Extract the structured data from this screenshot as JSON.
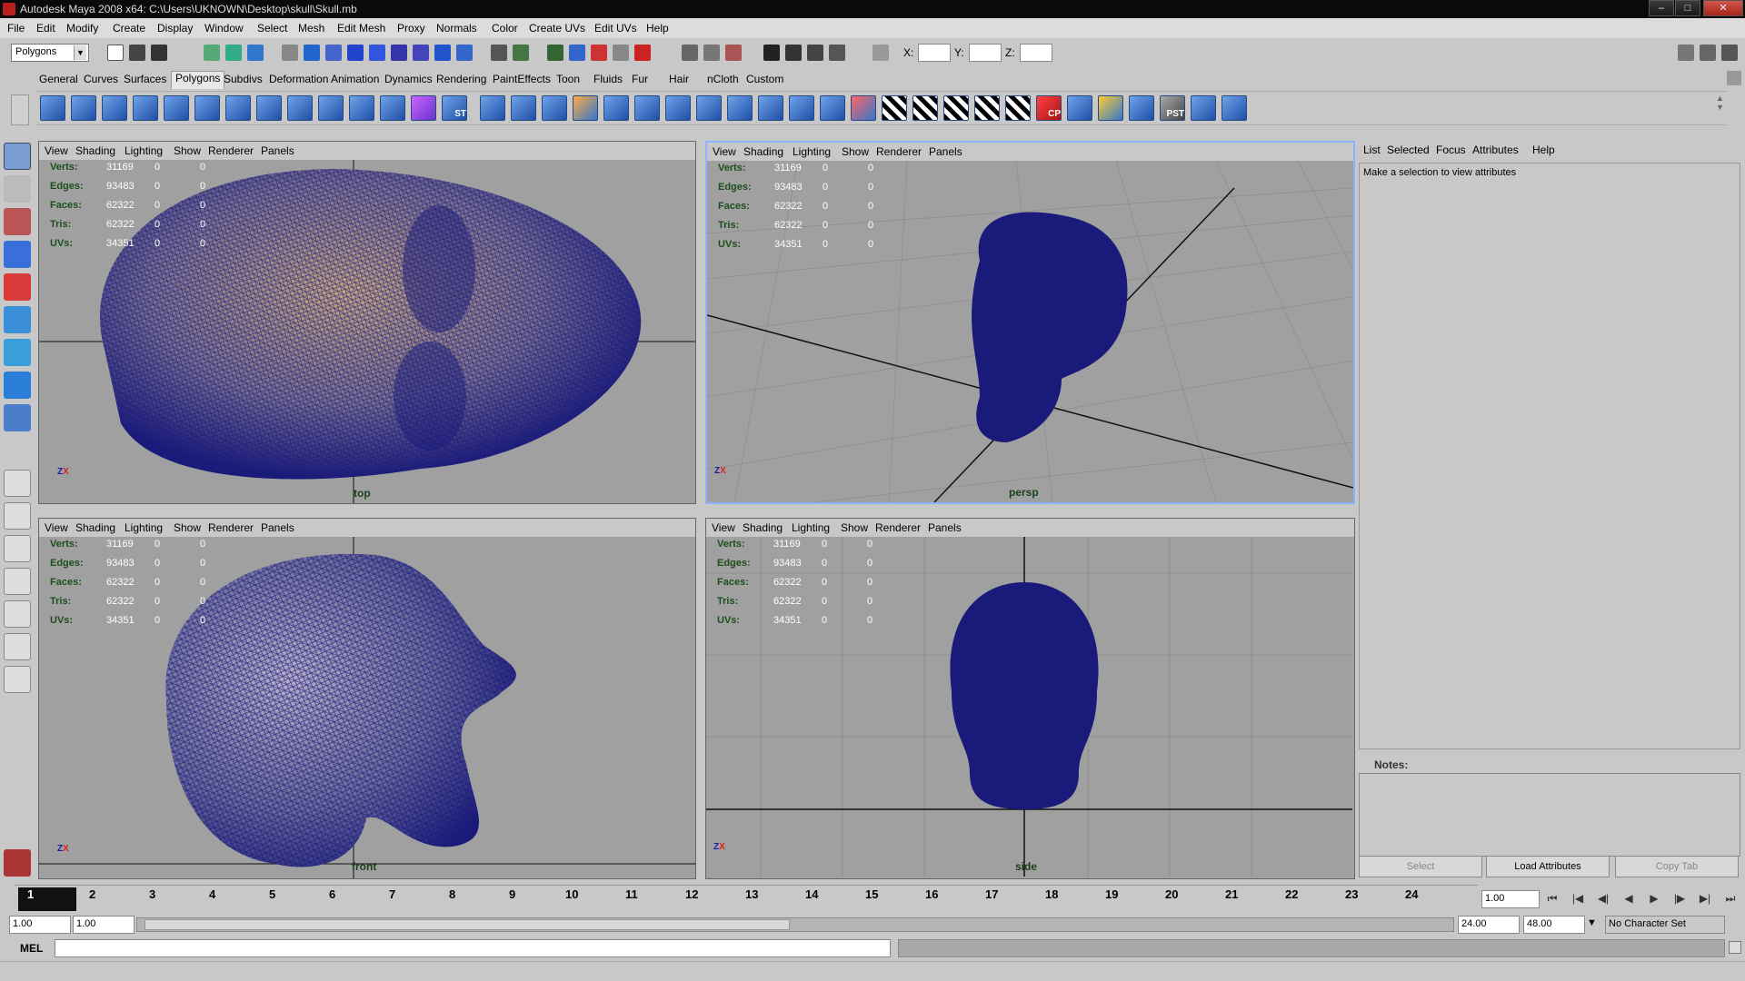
{
  "window": {
    "title": "Autodesk Maya 2008 x64: C:\\Users\\UKNOWN\\Desktop\\skull\\Skull.mb"
  },
  "menubar": [
    "File",
    "Edit",
    "Modify",
    "Create",
    "Display",
    "Window",
    "Select",
    "Mesh",
    "Edit Mesh",
    "Proxy",
    "Normals",
    "Color",
    "Create UVs",
    "Edit UVs",
    "Help"
  ],
  "toolbar": {
    "mode": "Polygons",
    "x_label": "X:",
    "y_label": "Y:",
    "z_label": "Z:"
  },
  "shelf_tabs": [
    "General",
    "Curves",
    "Surfaces",
    "Polygons",
    "Subdivs",
    "Deformation",
    "Animation",
    "Dynamics",
    "Rendering",
    "PaintEffects",
    "Toon",
    "Fluids",
    "Fur",
    "Hair",
    "nCloth",
    "Custom"
  ],
  "shelf_tab_active": "Polygons",
  "shelf_labels": {
    "st": "ST",
    "cp": "CP",
    "pst": "PST"
  },
  "viewport_menu": [
    "View",
    "Shading",
    "Lighting",
    "Show",
    "Renderer",
    "Panels"
  ],
  "hud": {
    "labels": [
      "Verts:",
      "Edges:",
      "Faces:",
      "Tris:",
      "UVs:"
    ],
    "values": [
      "31169",
      "93483",
      "62322",
      "62322",
      "34351"
    ],
    "zero": "0"
  },
  "viewports": [
    {
      "camera": "top"
    },
    {
      "camera": "persp"
    },
    {
      "camera": "front"
    },
    {
      "camera": "side"
    }
  ],
  "attribute_editor": {
    "menu": [
      "List",
      "Selected",
      "Focus",
      "Attributes",
      "Help"
    ],
    "message": "Make a selection to view attributes",
    "notes_label": "Notes:",
    "buttons": {
      "select": "Select",
      "load": "Load Attributes",
      "copy": "Copy Tab"
    }
  },
  "timeline": {
    "ticks": [
      "2",
      "3",
      "4",
      "5",
      "6",
      "7",
      "8",
      "9",
      "10",
      "11",
      "12",
      "13",
      "14",
      "15",
      "16",
      "17",
      "18",
      "19",
      "20",
      "21",
      "22",
      "23",
      "24"
    ],
    "current_frame": "1",
    "current_frame_field": "1.00"
  },
  "range": {
    "start_field": "1.00",
    "start_field2": "1.00",
    "end_field": "24.00",
    "end_field2": "48.00",
    "charset": "No Character Set"
  },
  "cmdline": {
    "label": "MEL"
  },
  "colors": {
    "mesh": "#1a1a7a",
    "viewport_bg": "#a0a0a0",
    "active_border": "#8ab4ff",
    "hud_label": "#1c4f1c"
  }
}
